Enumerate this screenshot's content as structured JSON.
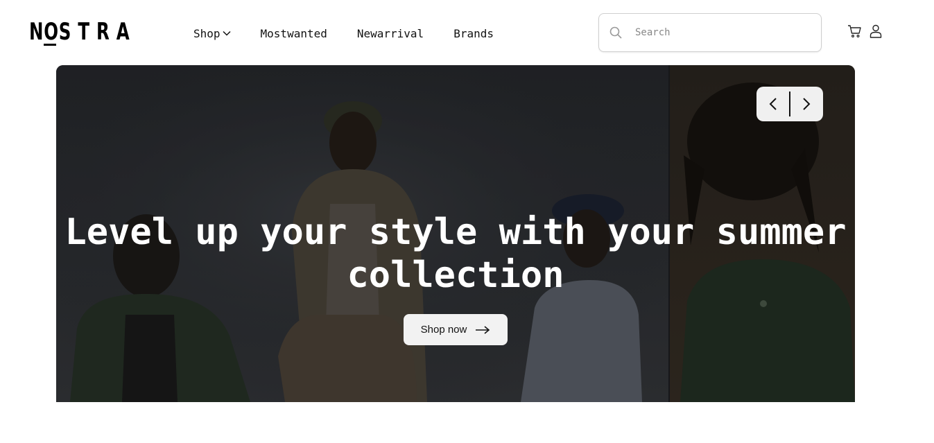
{
  "header": {
    "logo": "NOS T R A",
    "nav": [
      "Shop",
      "Mostwanted",
      "Newarrival",
      "Brands"
    ],
    "search": {
      "placeholder": "Search",
      "value": ""
    }
  },
  "icons": {
    "shop_dropdown": "chevron-down-icon",
    "search": "search-icon",
    "cart": "cart-icon",
    "user": "user-icon",
    "prev": "chevron-left-icon",
    "next": "chevron-right-icon",
    "shop_now": "arrow-right-icon"
  },
  "hero": {
    "title": "Level up your style with your summer collection",
    "cta": "Shop now"
  },
  "colors": {
    "hero_overlay": "#2a2c30",
    "button_bg": "#f2f2f2",
    "text": "#111111"
  }
}
